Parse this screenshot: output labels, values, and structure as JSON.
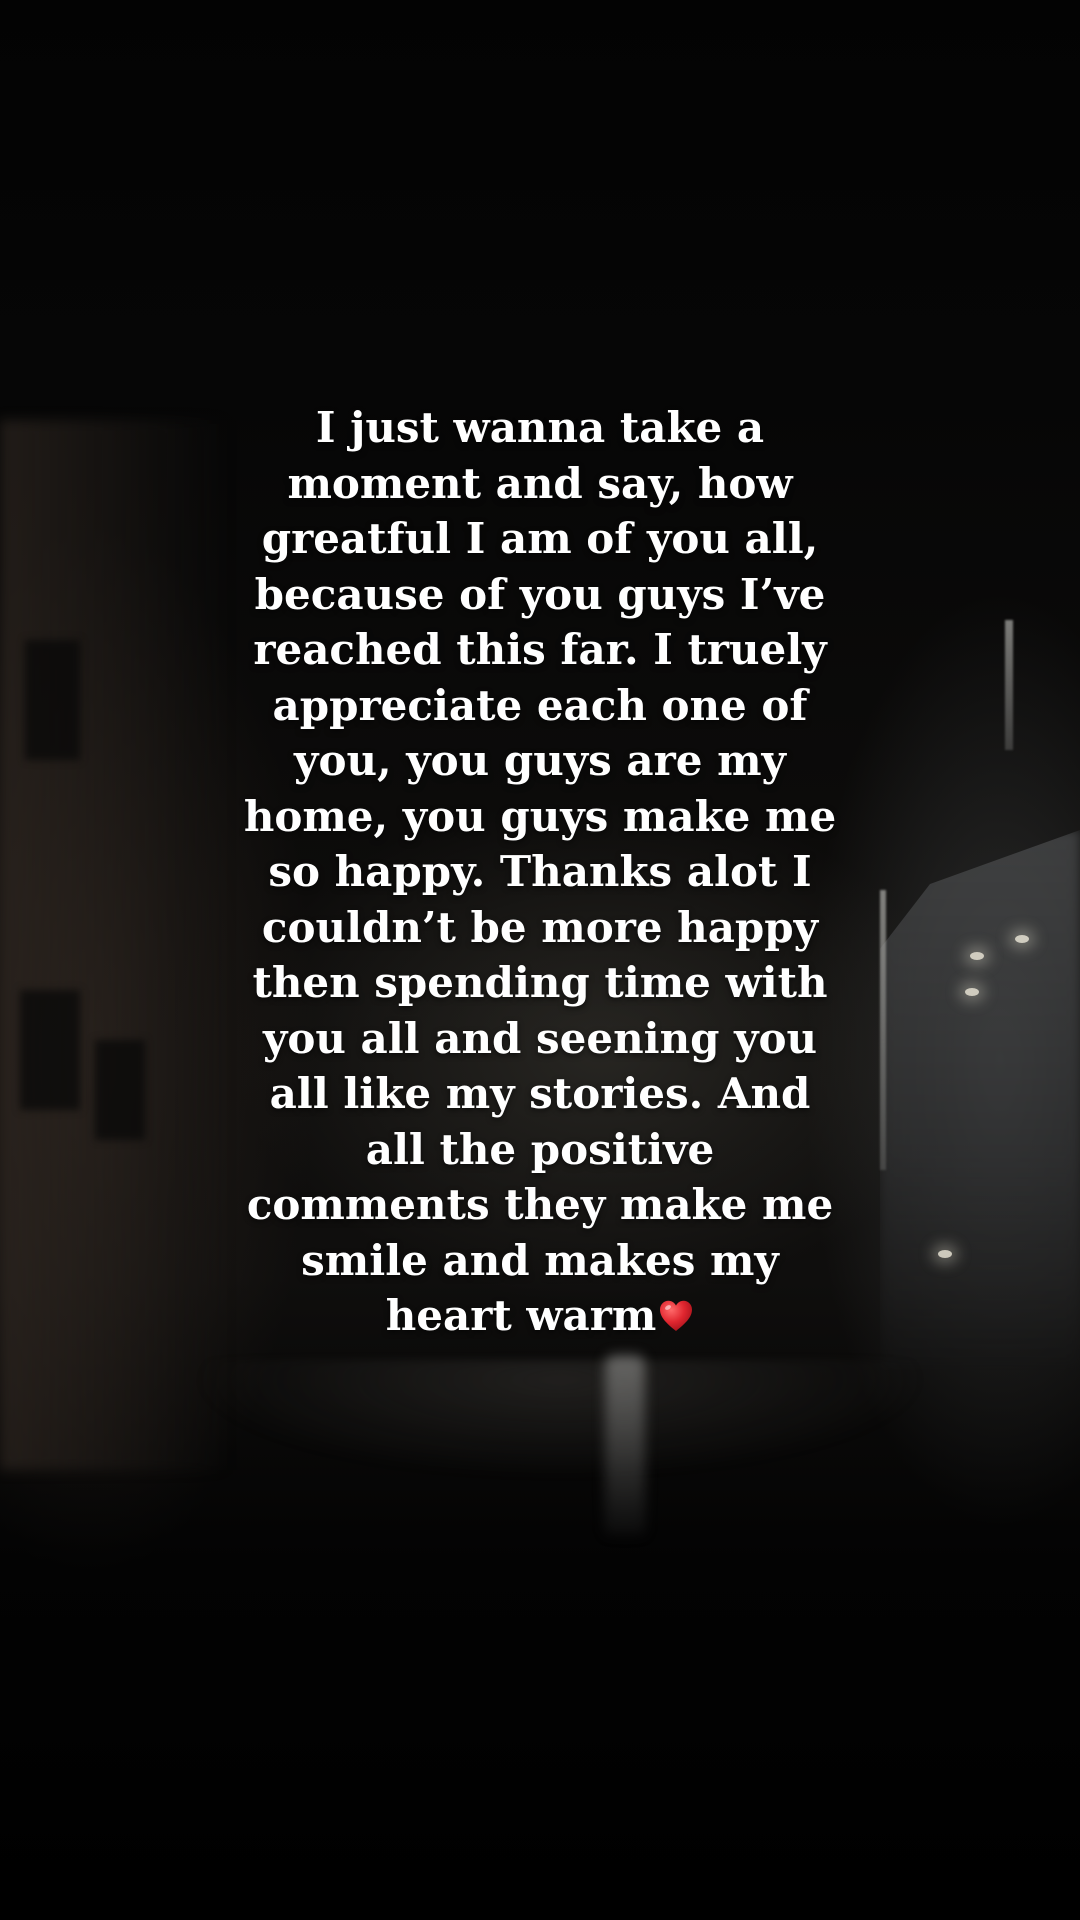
{
  "story": {
    "caption_lines": [
      "I just wanna take a",
      "moment and say, how",
      "greatful I am of you all,",
      "because of you guys I’ve",
      "reached this far. I truely",
      "appreciate each one of",
      "you, you guys are my",
      "home, you guys make me",
      "so happy. Thanks alot I",
      "couldn’t be more happy",
      "then spending time with",
      "you all and seening you",
      "all like my stories. And",
      "all the positive",
      "comments they make me",
      "smile and makes my",
      "heart warm"
    ],
    "emoji": "red-heart-icon"
  },
  "colors": {
    "text": "#ffffff",
    "heart": "#e0262f",
    "background": "#020202"
  }
}
